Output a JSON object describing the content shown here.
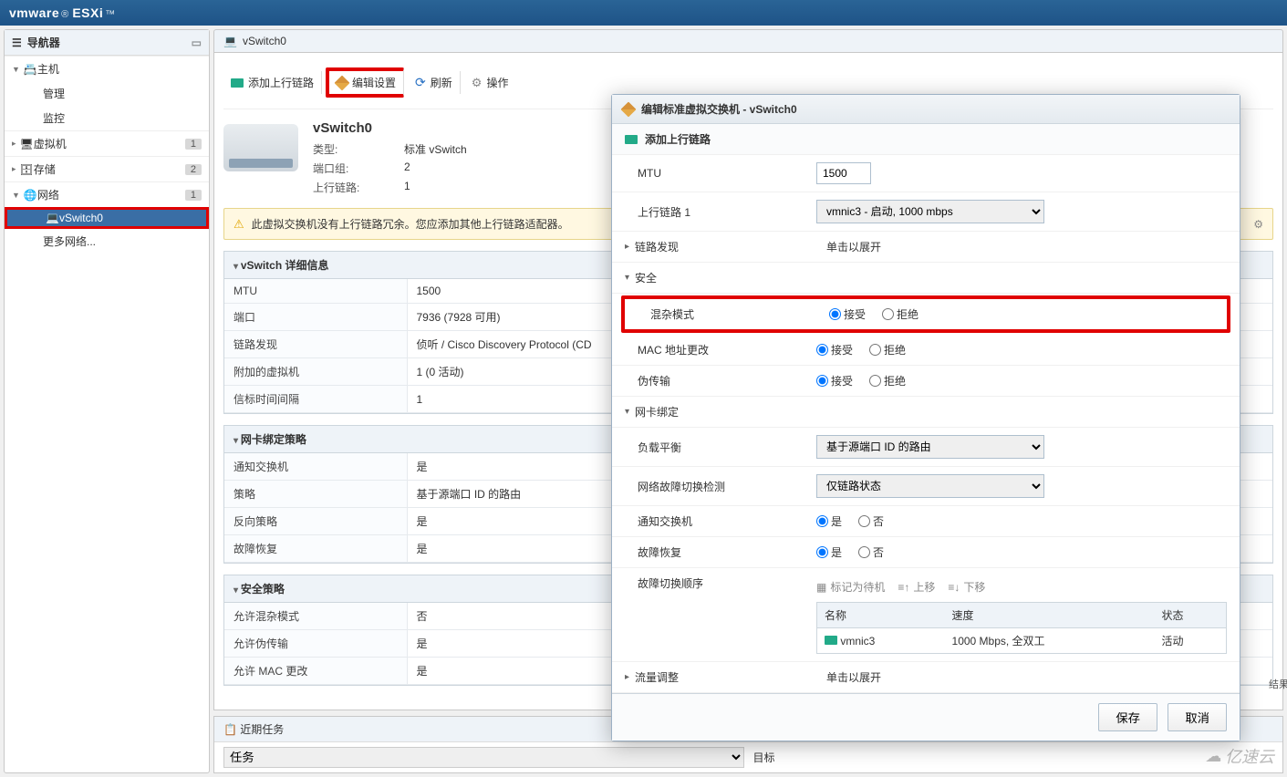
{
  "brand": {
    "name": "vmware",
    "product": "ESXi"
  },
  "nav": {
    "title": "导航器",
    "host": "主机",
    "items_host": [
      "管理",
      "监控"
    ],
    "groups": [
      {
        "label": "虚拟机",
        "badge": "1"
      },
      {
        "label": "存储",
        "badge": "2"
      },
      {
        "label": "网络",
        "badge": "1"
      }
    ],
    "selected": "vSwitch0",
    "more": "更多网络..."
  },
  "crumb": "vSwitch0",
  "toolbar": {
    "addUplink": "添加上行链路",
    "edit": "编辑设置",
    "refresh": "刷新",
    "actions": "操作"
  },
  "summary": {
    "title": "vSwitch0",
    "rows": [
      {
        "k": "类型:",
        "v": "标准 vSwitch"
      },
      {
        "k": "端口组:",
        "v": "2"
      },
      {
        "k": "上行链路:",
        "v": "1"
      }
    ]
  },
  "alert": "此虚拟交换机没有上行链路冗余。您应添加其他上行链路适配器。",
  "panels": {
    "details": {
      "title": "vSwitch 详细信息",
      "rows": [
        {
          "k": "MTU",
          "v": "1500"
        },
        {
          "k": "端口",
          "v": "7936 (7928 可用)"
        },
        {
          "k": "链路发现",
          "v": "侦听 / Cisco Discovery Protocol (CD"
        },
        {
          "k": "附加的虚拟机",
          "v": "1 (0 活动)"
        },
        {
          "k": "信标时间间隔",
          "v": "1"
        }
      ]
    },
    "teaming": {
      "title": "网卡绑定策略",
      "rows": [
        {
          "k": "通知交换机",
          "v": "是"
        },
        {
          "k": "策略",
          "v": "基于源端口 ID 的路由"
        },
        {
          "k": "反向策略",
          "v": "是"
        },
        {
          "k": "故障恢复",
          "v": "是"
        }
      ]
    },
    "security": {
      "title": "安全策略",
      "rows": [
        {
          "k": "允许混杂模式",
          "v": "否"
        },
        {
          "k": "允许伪传输",
          "v": "是"
        },
        {
          "k": "允许 MAC 更改",
          "v": "是"
        }
      ]
    }
  },
  "modal": {
    "title": "编辑标准虚拟交换机 - vSwitch0",
    "addUplink": "添加上行链路",
    "mtu": {
      "label": "MTU",
      "value": "1500"
    },
    "uplink": {
      "label": "上行链路 1",
      "option": "vmnic3 - 启动, 1000 mbps"
    },
    "linkDiscovery": {
      "label": "链路发现",
      "hint": "单击以展开"
    },
    "securityTitle": "安全",
    "security": [
      {
        "label": "混杂模式",
        "accept": "接受",
        "reject": "拒绝",
        "sel": "accept"
      },
      {
        "label": "MAC 地址更改",
        "accept": "接受",
        "reject": "拒绝",
        "sel": "accept"
      },
      {
        "label": "伪传输",
        "accept": "接受",
        "reject": "拒绝",
        "sel": "accept"
      }
    ],
    "nicTitle": "网卡绑定",
    "nic": {
      "loadBalance": {
        "label": "负载平衡",
        "option": "基于源端口 ID 的路由"
      },
      "failDetect": {
        "label": "网络故障切换检测",
        "option": "仅链路状态"
      },
      "notify": {
        "label": "通知交换机",
        "yes": "是",
        "no": "否"
      },
      "failback": {
        "label": "故障恢复",
        "yes": "是",
        "no": "否"
      },
      "failOrder": "故障切换顺序",
      "mini": [
        "标记为待机",
        "上移",
        "下移"
      ],
      "table": {
        "h": [
          "名称",
          "速度",
          "状态"
        ],
        "r": [
          "vmnic3",
          "1000 Mbps, 全双工",
          "活动"
        ]
      }
    },
    "traffic": {
      "label": "流量调整",
      "hint": "单击以展开"
    },
    "save": "保存",
    "cancel": "取消"
  },
  "tasks": {
    "title": "近期任务",
    "cols": [
      "任务",
      "目标"
    ],
    "result": "结果"
  },
  "watermark": "亿速云"
}
